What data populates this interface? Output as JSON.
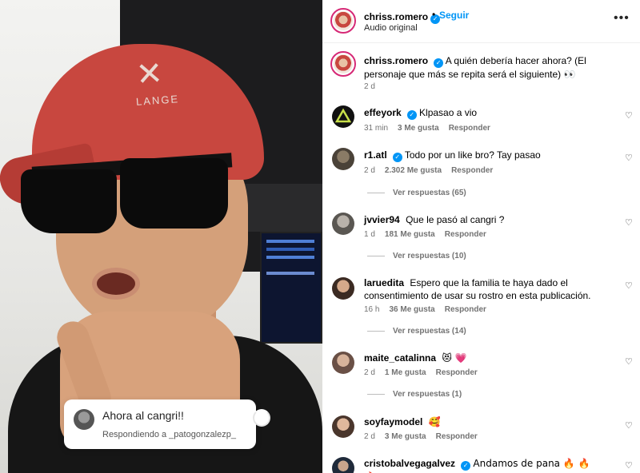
{
  "video": {
    "cap_logo": "✕",
    "cap_text": "LANGE",
    "reply_card": {
      "title": "Ahora al cangri!!",
      "subtitle": "Respondiendo a _patogonzalezp_"
    }
  },
  "post": {
    "username": "chriss.romero",
    "follow_label": "Seguir",
    "dot": "•",
    "audio": "Audio original",
    "more_icon": "•••",
    "verified_icon": "✓"
  },
  "caption": {
    "username": "chriss.romero",
    "text": "A quién debería hacer ahora? (El personaje que más se repita será el siguiente) 👀",
    "time": "2 d"
  },
  "comments": [
    {
      "username": "effeyork",
      "verified": true,
      "text": "Klpasao a vio",
      "time": "31 min",
      "likes": "3 Me gusta",
      "reply": "Responder",
      "replies": ""
    },
    {
      "username": "r1.atl",
      "verified": true,
      "text": "Todo por un like bro? Tay pasao",
      "time": "2 d",
      "likes": "2.302 Me gusta",
      "reply": "Responder",
      "replies": "Ver respuestas (65)"
    },
    {
      "username": "jvvier94",
      "verified": false,
      "text": "Que le pasó al cangri ?",
      "time": "1 d",
      "likes": "181 Me gusta",
      "reply": "Responder",
      "replies": "Ver respuestas (10)"
    },
    {
      "username": "laruedita",
      "verified": false,
      "text": "Espero que la familia te haya dado el consentimiento de usar su rostro en esta publicación.",
      "time": "16 h",
      "likes": "36 Me gusta",
      "reply": "Responder",
      "replies": "Ver respuestas (14)"
    },
    {
      "username": "maite_catalinna",
      "verified": false,
      "text": "😻 💗",
      "time": "2 d",
      "likes": "1 Me gusta",
      "reply": "Responder",
      "replies": "Ver respuestas (1)"
    },
    {
      "username": "soyfaymodel",
      "verified": false,
      "text": "🥰",
      "time": "2 d",
      "likes": "3 Me gusta",
      "reply": "Responder",
      "replies": ""
    },
    {
      "username": "cristobalvegagalvez",
      "verified": true,
      "text": "Andamos de pana 🔥 🔥 🔥",
      "time": "",
      "likes": "",
      "reply": "",
      "replies": ""
    }
  ],
  "icons": {
    "heart": "♡"
  },
  "colors": {
    "accent": "#0095f6",
    "story_ring": "#d62976",
    "meta_text": "#737373"
  }
}
